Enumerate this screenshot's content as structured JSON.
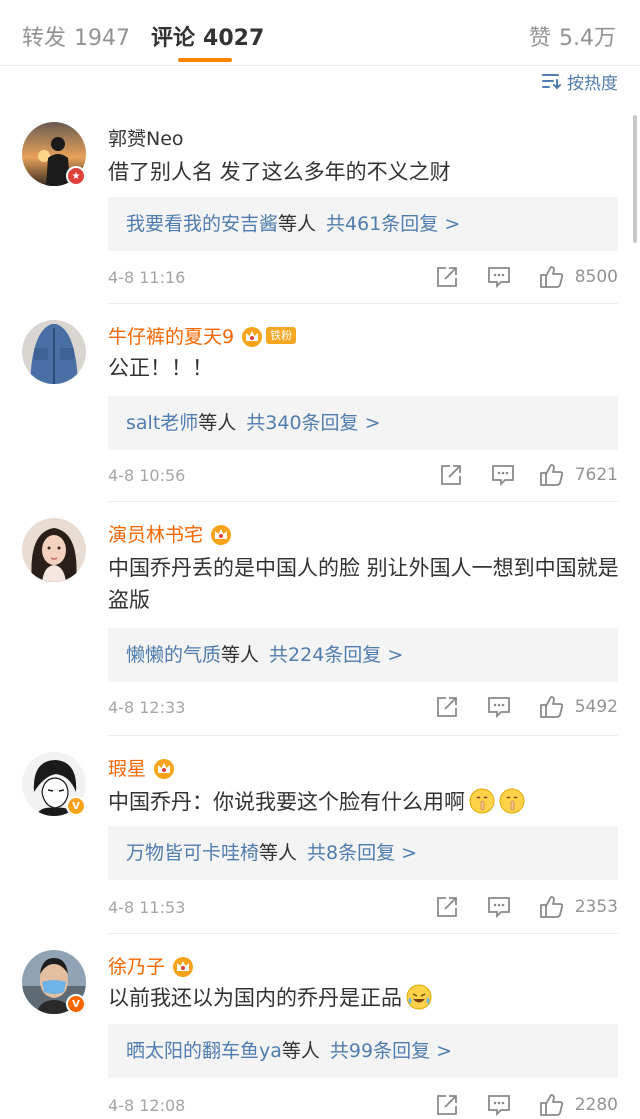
{
  "tabs": {
    "repost_label": "转发",
    "repost_count": "1947",
    "comments_label": "评论",
    "comments_count": "4027",
    "likes_label": "赞",
    "likes_count": "5.4万",
    "accent_color": "#ff8200"
  },
  "sort": {
    "label": "按热度",
    "icon": "sort-lines-icon"
  },
  "colors": {
    "link": "#507daf",
    "vip_name": "#f86600",
    "meta": "#a5a5a5"
  },
  "comments": [
    {
      "username": "郭赟Neo",
      "name_style": "plain",
      "badge": "red-v",
      "text": "借了别人名 发了这么多年的不义之财",
      "reply_names": "我要看我的安吉酱",
      "reply_suffix": "等人",
      "reply_count": "共461条回复 >",
      "time": "4-8 11:16",
      "likes": "8500"
    },
    {
      "username": "牛仔裤的夏天9",
      "name_style": "vip",
      "fan_badge": "铁粉",
      "text": "公正！！！",
      "reply_names": "salt老师",
      "reply_suffix": "等人",
      "reply_count": "共340条回复 >",
      "time": "4-8 10:56",
      "likes": "7621"
    },
    {
      "username": "演员林书宅",
      "name_style": "vip",
      "text": "中国乔丹丢的是中国人的脸 别让外国人一想到中国就是盗版",
      "reply_names": "懒懒的气质",
      "reply_suffix": "等人",
      "reply_count": "共224条回复 >",
      "time": "4-8 12:33",
      "likes": "5492"
    },
    {
      "username": "瑕星",
      "name_style": "vip",
      "badge": "yellow-v",
      "text": "中国乔丹：你说我要这个脸有什么用啊",
      "emojis": [
        "shush-emoji",
        "shush-emoji"
      ],
      "reply_names": "万物皆可卡哇椅",
      "reply_suffix": "等人",
      "reply_count": "共8条回复 >",
      "time": "4-8 11:53",
      "likes": "2353"
    },
    {
      "username": "徐乃子",
      "name_style": "vip",
      "badge": "orange-v",
      "text": "以前我还以为国内的乔丹是正品",
      "emojis": [
        "crying-laugh-emoji"
      ],
      "reply_names": "晒太阳的翻车鱼ya",
      "reply_suffix": "等人",
      "reply_count": "共99条回复 >",
      "time": "4-8 12:08",
      "likes": "2280"
    }
  ]
}
